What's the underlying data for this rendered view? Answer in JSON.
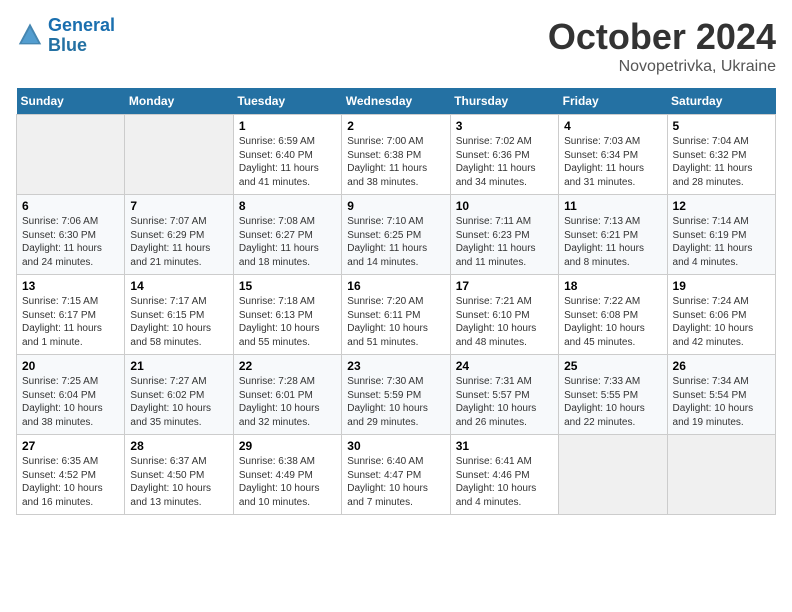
{
  "header": {
    "logo_line1": "General",
    "logo_line2": "Blue",
    "month": "October 2024",
    "location": "Novopetrivka, Ukraine"
  },
  "days_of_week": [
    "Sunday",
    "Monday",
    "Tuesday",
    "Wednesday",
    "Thursday",
    "Friday",
    "Saturday"
  ],
  "weeks": [
    [
      {
        "day": "",
        "info": ""
      },
      {
        "day": "",
        "info": ""
      },
      {
        "day": "1",
        "info": "Sunrise: 6:59 AM\nSunset: 6:40 PM\nDaylight: 11 hours and 41 minutes."
      },
      {
        "day": "2",
        "info": "Sunrise: 7:00 AM\nSunset: 6:38 PM\nDaylight: 11 hours and 38 minutes."
      },
      {
        "day": "3",
        "info": "Sunrise: 7:02 AM\nSunset: 6:36 PM\nDaylight: 11 hours and 34 minutes."
      },
      {
        "day": "4",
        "info": "Sunrise: 7:03 AM\nSunset: 6:34 PM\nDaylight: 11 hours and 31 minutes."
      },
      {
        "day": "5",
        "info": "Sunrise: 7:04 AM\nSunset: 6:32 PM\nDaylight: 11 hours and 28 minutes."
      }
    ],
    [
      {
        "day": "6",
        "info": "Sunrise: 7:06 AM\nSunset: 6:30 PM\nDaylight: 11 hours and 24 minutes."
      },
      {
        "day": "7",
        "info": "Sunrise: 7:07 AM\nSunset: 6:29 PM\nDaylight: 11 hours and 21 minutes."
      },
      {
        "day": "8",
        "info": "Sunrise: 7:08 AM\nSunset: 6:27 PM\nDaylight: 11 hours and 18 minutes."
      },
      {
        "day": "9",
        "info": "Sunrise: 7:10 AM\nSunset: 6:25 PM\nDaylight: 11 hours and 14 minutes."
      },
      {
        "day": "10",
        "info": "Sunrise: 7:11 AM\nSunset: 6:23 PM\nDaylight: 11 hours and 11 minutes."
      },
      {
        "day": "11",
        "info": "Sunrise: 7:13 AM\nSunset: 6:21 PM\nDaylight: 11 hours and 8 minutes."
      },
      {
        "day": "12",
        "info": "Sunrise: 7:14 AM\nSunset: 6:19 PM\nDaylight: 11 hours and 4 minutes."
      }
    ],
    [
      {
        "day": "13",
        "info": "Sunrise: 7:15 AM\nSunset: 6:17 PM\nDaylight: 11 hours and 1 minute."
      },
      {
        "day": "14",
        "info": "Sunrise: 7:17 AM\nSunset: 6:15 PM\nDaylight: 10 hours and 58 minutes."
      },
      {
        "day": "15",
        "info": "Sunrise: 7:18 AM\nSunset: 6:13 PM\nDaylight: 10 hours and 55 minutes."
      },
      {
        "day": "16",
        "info": "Sunrise: 7:20 AM\nSunset: 6:11 PM\nDaylight: 10 hours and 51 minutes."
      },
      {
        "day": "17",
        "info": "Sunrise: 7:21 AM\nSunset: 6:10 PM\nDaylight: 10 hours and 48 minutes."
      },
      {
        "day": "18",
        "info": "Sunrise: 7:22 AM\nSunset: 6:08 PM\nDaylight: 10 hours and 45 minutes."
      },
      {
        "day": "19",
        "info": "Sunrise: 7:24 AM\nSunset: 6:06 PM\nDaylight: 10 hours and 42 minutes."
      }
    ],
    [
      {
        "day": "20",
        "info": "Sunrise: 7:25 AM\nSunset: 6:04 PM\nDaylight: 10 hours and 38 minutes."
      },
      {
        "day": "21",
        "info": "Sunrise: 7:27 AM\nSunset: 6:02 PM\nDaylight: 10 hours and 35 minutes."
      },
      {
        "day": "22",
        "info": "Sunrise: 7:28 AM\nSunset: 6:01 PM\nDaylight: 10 hours and 32 minutes."
      },
      {
        "day": "23",
        "info": "Sunrise: 7:30 AM\nSunset: 5:59 PM\nDaylight: 10 hours and 29 minutes."
      },
      {
        "day": "24",
        "info": "Sunrise: 7:31 AM\nSunset: 5:57 PM\nDaylight: 10 hours and 26 minutes."
      },
      {
        "day": "25",
        "info": "Sunrise: 7:33 AM\nSunset: 5:55 PM\nDaylight: 10 hours and 22 minutes."
      },
      {
        "day": "26",
        "info": "Sunrise: 7:34 AM\nSunset: 5:54 PM\nDaylight: 10 hours and 19 minutes."
      }
    ],
    [
      {
        "day": "27",
        "info": "Sunrise: 6:35 AM\nSunset: 4:52 PM\nDaylight: 10 hours and 16 minutes."
      },
      {
        "day": "28",
        "info": "Sunrise: 6:37 AM\nSunset: 4:50 PM\nDaylight: 10 hours and 13 minutes."
      },
      {
        "day": "29",
        "info": "Sunrise: 6:38 AM\nSunset: 4:49 PM\nDaylight: 10 hours and 10 minutes."
      },
      {
        "day": "30",
        "info": "Sunrise: 6:40 AM\nSunset: 4:47 PM\nDaylight: 10 hours and 7 minutes."
      },
      {
        "day": "31",
        "info": "Sunrise: 6:41 AM\nSunset: 4:46 PM\nDaylight: 10 hours and 4 minutes."
      },
      {
        "day": "",
        "info": ""
      },
      {
        "day": "",
        "info": ""
      }
    ]
  ]
}
